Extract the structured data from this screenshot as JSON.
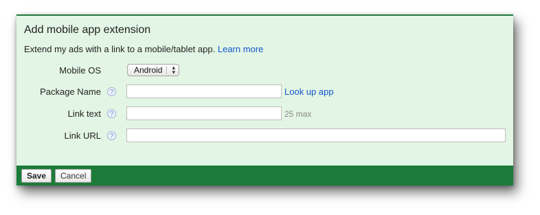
{
  "panel": {
    "title": "Add mobile app extension",
    "description": "Extend my ads with a link to a mobile/tablet app.",
    "learn_more": "Learn more"
  },
  "fields": {
    "mobile_os": {
      "label": "Mobile OS",
      "value": "Android"
    },
    "package_name": {
      "label": "Package Name",
      "value": "",
      "placeholder": "",
      "lookup_label": "Look up app"
    },
    "link_text": {
      "label": "Link text",
      "value": "",
      "placeholder": "",
      "hint": "25 max"
    },
    "link_url": {
      "label": "Link URL",
      "value": "",
      "placeholder": ""
    }
  },
  "help_icon_glyph": "?",
  "footer": {
    "save_label": "Save",
    "cancel_label": "Cancel"
  },
  "colors": {
    "panel_bg": "#e3f5e4",
    "footer_bg": "#1b7c39",
    "link": "#1155cc"
  }
}
